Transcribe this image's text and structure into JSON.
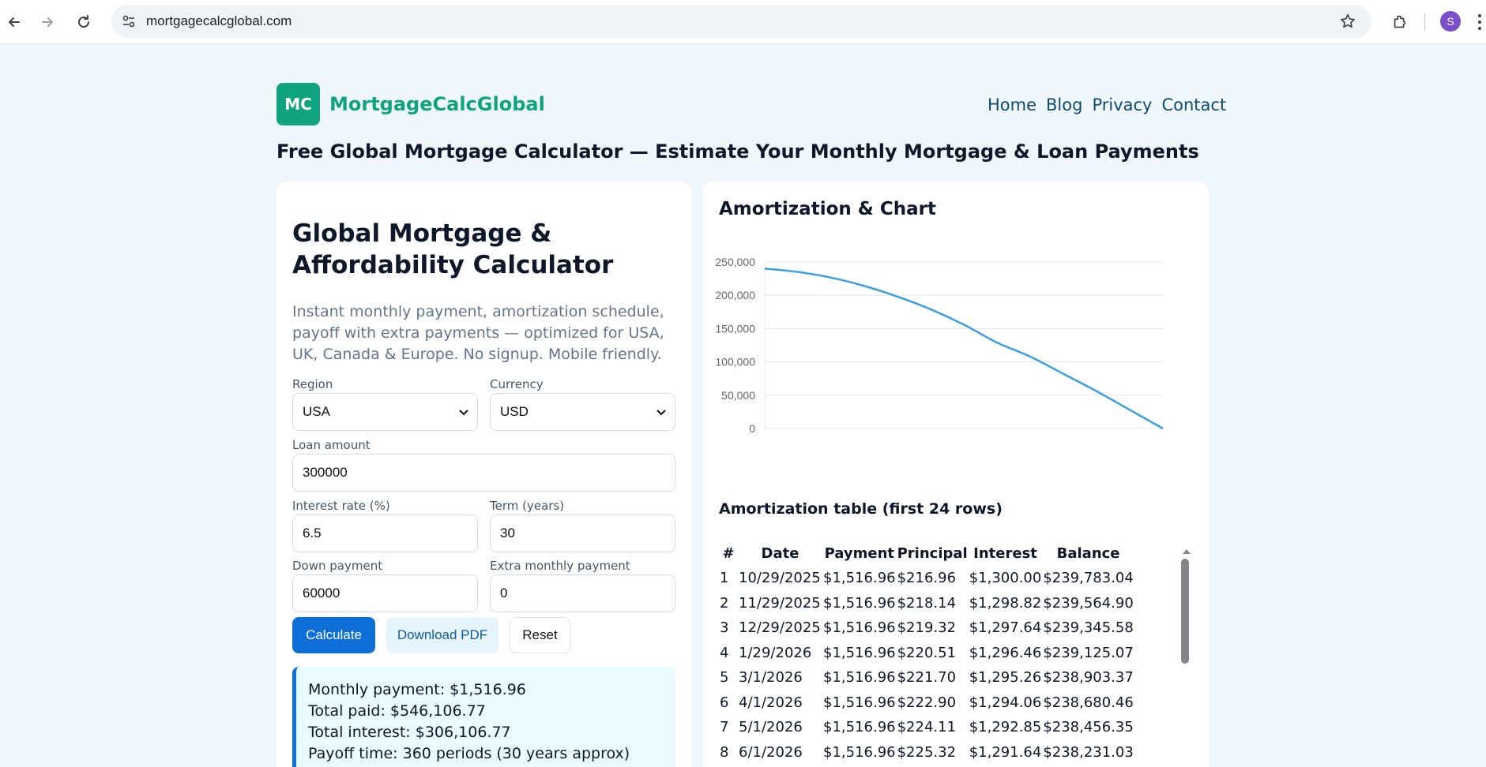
{
  "browser": {
    "url": "mortgagecalcglobal.com",
    "profile_initial": "S"
  },
  "header": {
    "logo_text": "MC",
    "brand_name": "MortgageCalcGlobal",
    "nav": [
      "Home",
      "Blog",
      "Privacy",
      "Contact"
    ],
    "headline": "Free Global Mortgage Calculator — Estimate Your Monthly Mortgage & Loan Payments"
  },
  "calculator": {
    "title": "Global Mortgage & Affordability Calculator",
    "description": "Instant monthly payment, amortization schedule, payoff with extra payments — optimized for USA, UK, Canada & Europe. No signup. Mobile friendly.",
    "region": {
      "label": "Region",
      "value": "USA"
    },
    "currency": {
      "label": "Currency",
      "value": "USD"
    },
    "loan_amount": {
      "label": "Loan amount",
      "value": "300000"
    },
    "interest_rate": {
      "label": "Interest rate (%)",
      "value": "6.5"
    },
    "term": {
      "label": "Term (years)",
      "value": "30"
    },
    "down_payment": {
      "label": "Down payment",
      "value": "60000"
    },
    "extra_payment": {
      "label": "Extra monthly payment",
      "value": "0"
    },
    "buttons": {
      "calculate": "Calculate",
      "download": "Download PDF",
      "reset": "Reset"
    },
    "results": [
      "Monthly payment: $1,516.96",
      "Total paid: $546,106.77",
      "Total interest: $306,106.77",
      "Payoff time: 360 periods (30 years approx)"
    ]
  },
  "amortization": {
    "title": "Amortization & Chart",
    "table_title": "Amortization table (first 24 rows)",
    "columns": [
      "#",
      "Date",
      "Payment",
      "Principal",
      "Interest",
      "Balance"
    ],
    "rows": [
      [
        "1",
        "10/29/2025",
        "$1,516.96",
        "$216.96",
        "$1,300.00",
        "$239,783.04"
      ],
      [
        "2",
        "11/29/2025",
        "$1,516.96",
        "$218.14",
        "$1,298.82",
        "$239,564.90"
      ],
      [
        "3",
        "12/29/2025",
        "$1,516.96",
        "$219.32",
        "$1,297.64",
        "$239,345.58"
      ],
      [
        "4",
        "1/29/2026",
        "$1,516.96",
        "$220.51",
        "$1,296.46",
        "$239,125.07"
      ],
      [
        "5",
        "3/1/2026",
        "$1,516.96",
        "$221.70",
        "$1,295.26",
        "$238,903.37"
      ],
      [
        "6",
        "4/1/2026",
        "$1,516.96",
        "$222.90",
        "$1,294.06",
        "$238,680.46"
      ],
      [
        "7",
        "5/1/2026",
        "$1,516.96",
        "$224.11",
        "$1,292.85",
        "$238,456.35"
      ],
      [
        "8",
        "6/1/2026",
        "$1,516.96",
        "$225.32",
        "$1,291.64",
        "$238,231.03"
      ]
    ]
  },
  "chart_data": {
    "type": "line",
    "ylim": [
      0,
      250000
    ],
    "yticks": [
      "250,000",
      "200,000",
      "150,000",
      "100,000",
      "50,000",
      "0"
    ],
    "x": [
      0,
      30,
      60,
      90,
      120,
      150,
      180,
      210,
      240,
      270,
      300,
      330,
      360
    ],
    "values": [
      240000,
      235000,
      226500,
      214000,
      198000,
      179000,
      156000,
      129000,
      108000,
      82000,
      56000,
      28000,
      0
    ],
    "color": "#3b9fe0",
    "grid": true
  }
}
